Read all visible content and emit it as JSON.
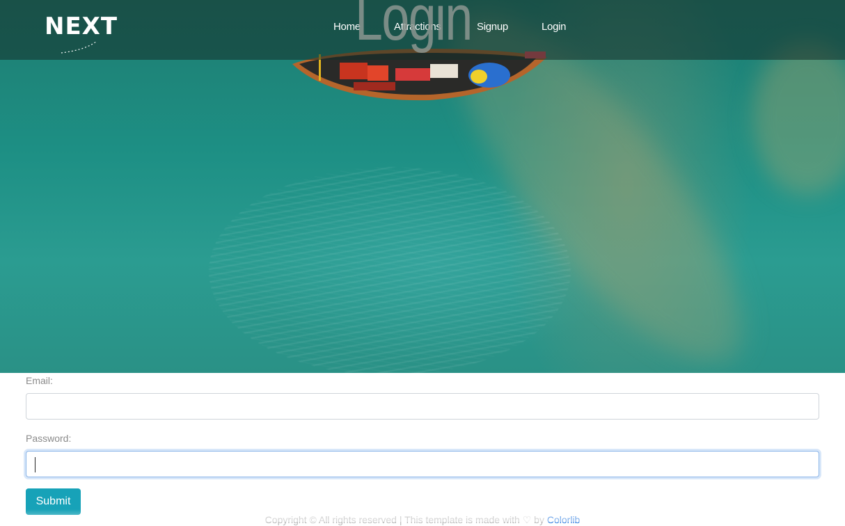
{
  "brand": {
    "logo_text": "NEXT"
  },
  "nav": {
    "items": [
      {
        "label": "Home"
      },
      {
        "label": "Attractions"
      },
      {
        "label": "Signup"
      },
      {
        "label": "Login"
      }
    ]
  },
  "hero": {
    "title": "Login"
  },
  "form": {
    "email_label": "Email:",
    "email_value": "",
    "password_label": "Password:",
    "password_value": "",
    "submit_label": "Submit"
  },
  "footer": {
    "text": "Copyright © All rights reserved | This template is made with ♡ by ",
    "link_text": "Colorlib"
  },
  "colors": {
    "accent": "#17a2b8",
    "link": "#2f7ee0",
    "nav_text": "#ffffff"
  }
}
